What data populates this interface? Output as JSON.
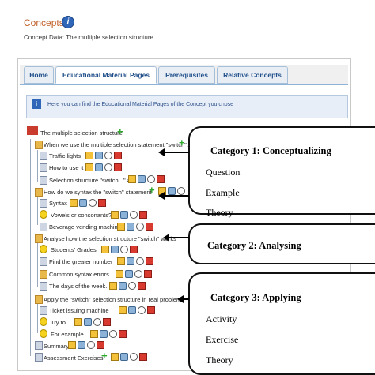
{
  "header": {
    "title": "Concepts",
    "concept_data_label": "Concept Data:",
    "concept_data_value": "The multiple selection structure"
  },
  "tabs": [
    {
      "label": "Home"
    },
    {
      "label": "Educational Material Pages"
    },
    {
      "label": "Prerequisites"
    },
    {
      "label": "Relative Concepts"
    }
  ],
  "info_text": "Here you can find the Educational Material Pages of the Concept you chose",
  "tree": {
    "root": "The multiple selection structure",
    "items": [
      {
        "label": "When we use the multiple selection statement \"switch\"..."
      },
      {
        "label": "Traffic lights"
      },
      {
        "label": "How to use it"
      },
      {
        "label": "Selection structure \"switch...\" a..."
      },
      {
        "label": "How do we syntax the \"switch\" statement"
      },
      {
        "label": "Syntax"
      },
      {
        "label": "Vowels or consonants?"
      },
      {
        "label": "Beverage vending machines"
      },
      {
        "label": "Analyse how the selection structure \"switch\" works"
      },
      {
        "label": "Students' Grades"
      },
      {
        "label": "Find the greater number"
      },
      {
        "label": "Common syntax errors"
      },
      {
        "label": "The days of the week..."
      },
      {
        "label": "Apply the \"switch\" selection structure in real problems"
      },
      {
        "label": "Ticket issuing machine"
      },
      {
        "label": "Try to..."
      },
      {
        "label": "For example..."
      },
      {
        "label": "Summary"
      },
      {
        "label": "Assessment Exercises"
      }
    ]
  },
  "callouts": [
    {
      "title": "Category 1: Conceptualizing",
      "items": [
        "Question",
        "Example",
        "Theory"
      ]
    },
    {
      "title": "Category 2: Analysing",
      "items": []
    },
    {
      "title": "Category 3: Applying",
      "items": [
        "Activity",
        "Exercise",
        "Theory"
      ]
    }
  ],
  "colors": {
    "accent": "#c0612a",
    "tab_text": "#1f4e8a",
    "info_bg": "#e8eef8"
  }
}
